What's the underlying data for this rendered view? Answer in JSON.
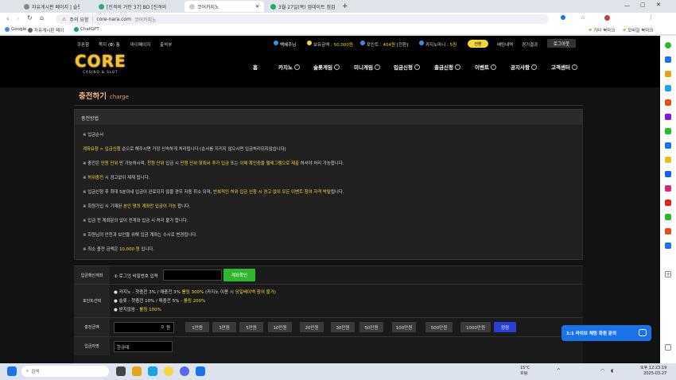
{
  "browser": {
    "tabs": [
      {
        "label": "자유게시판 페이지 | 슬롯나라"
      },
      {
        "label": "[진격의 거인 37] BD [진격의"
      },
      {
        "label": "코어카지노"
      },
      {
        "label": "3월 27일(목) 업데이트 점검 안"
      }
    ],
    "new_tab": "+",
    "security": "주의 요함",
    "url": "core-nara.com",
    "url_suffix": "코어카지노",
    "bookmarks": [
      "Google",
      "자유게시판 페이",
      "ChatGPT"
    ],
    "bookmarks_right": [
      "기타 북마크",
      "모바일 북마크"
    ]
  },
  "site": {
    "top": {
      "coupon": "쿠폰함",
      "note_label": "쪽지 (",
      "note_count": "0",
      "note_suffix": ") 통",
      "mypage": "마이페이지",
      "attendance": "출석부",
      "username": "백혜주님",
      "holding_label": "보유금액 :",
      "holding_value": "50,000원",
      "point_label": "포인트 :",
      "point_value": "404원",
      "point_action": "[전환]",
      "casino_mileage_label": "카지노마니 :",
      "casino_mileage_value": "5원",
      "convert_btn": "전환",
      "betting": "배팅내역",
      "results": "경기결과",
      "logout": "로그아웃"
    },
    "logo": {
      "main": "CORE",
      "sub": "CASINO & SLOT"
    },
    "nav": [
      "홈",
      "카지노",
      "슬롯게임",
      "미니게임",
      "입금신청",
      "출금신청",
      "이벤트",
      "공지사항",
      "고객센터"
    ],
    "page_title": "충전하기",
    "page_title_en": "charge",
    "info_header": "충전방법",
    "info": {
      "l1": "※ 입금순서",
      "l2a": "계좌요청 > 입금신청",
      "l2b": " 순으로 해주시면 가장 신속하게 처리됩니다 (순서를 지키지 않으시면 입금처리되지않습니다)",
      "l3a": "※ 충전은 ",
      "l3b": "만원 단위",
      "l3c": " 만 가능하시며, ",
      "l3d": "천원 단위",
      "l3e": " 입금 시 ",
      "l3f": "만원 단위 맞춰서 추가 입금",
      "l3g": " 또는 ",
      "l3h": "이체 확인증을 텔레그램으로 제출",
      "l3i": " 하셔야 처리 가능합니다.",
      "l4a": "※ ",
      "l4b": "허위충전",
      "l4c": " 시 경고없이 제재 됩니다.",
      "l5a": "※ 입금신청 후 최대 5분이내 입금이 완료되지 않을 경우 자동 취소 되며, ",
      "l5b": "반복적인 허위 입금 신청 시 경고 없이 모든 이벤트 참여 자격 박탈",
      "l5c": "됩니다.",
      "l6a": "※ 회원가입 시 기재된 ",
      "l6b": "본인 명의 계좌만 입금이 가능",
      "l6c": " 합니다.",
      "l7": "※ 입금 전 계좌문의 없이 전계좌 입금 시 처리 불가 합니다.",
      "l8": "※ 회원님의 안전과 보안을 위해 입금 계좌는 수시로 변경됩니다.",
      "l9a": "※ 최소 충전 금액은 ",
      "l9b": "10,000 원",
      "l9c": " 입니다."
    },
    "form": {
      "row1_label": "입금확인계좌",
      "row1_text": "① 로그인 비밀번호 입력",
      "row1_btn": "계좌확인",
      "row2_label": "포인트선택",
      "opt1a": "카지노 - 첫충전 3% / 매충전 3% ",
      "opt1b": "롤링 300%",
      "opt1c": " (카지노 이용 시 ",
      "opt1d": "당일베이백 참여 불가",
      "opt1e": ")",
      "opt2a": "슬롯 - 첫충전 10% / 매충전 5% - ",
      "opt2b": "롤링 200%",
      "opt3a": "받지않음 - ",
      "opt3b": "롤링 100%",
      "row3_label": "충전금액",
      "amount_value": "0",
      "amount_unit": "원",
      "amounts": [
        "1만원",
        "3만원",
        "5만원",
        "10만원",
        "20만원",
        "30만원",
        "50만원",
        "100만원",
        "500만원",
        "1000만원"
      ],
      "reset": "정정",
      "row4_label": "입금자명",
      "depositor": "한규태"
    },
    "chat": "1:1 라이브 채팅 화원 문의"
  },
  "taskbar": {
    "search": "검색",
    "weather_temp": "15°C",
    "weather_desc": "흐림",
    "time": "오후 12:23:19",
    "date": "2025-03-27"
  },
  "colors": {
    "accent_yellow": "#f4d63d",
    "title_orange": "#f5b88a",
    "confirm_green": "#2eb82e",
    "reset_blue": "#2a3fd6",
    "chat_blue": "#1a73e8"
  }
}
